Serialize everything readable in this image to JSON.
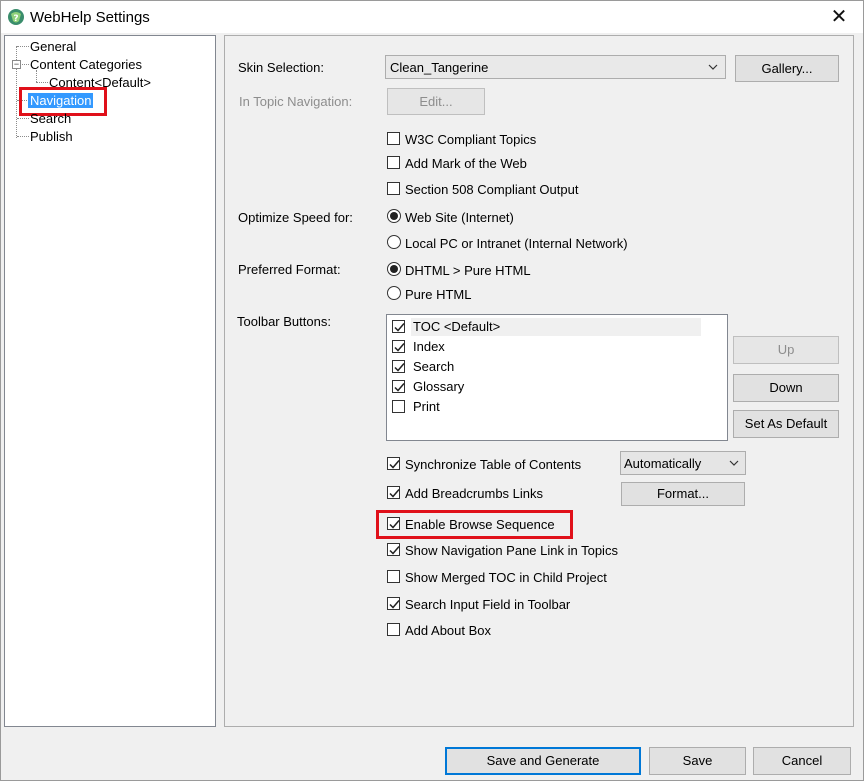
{
  "window": {
    "title": "WebHelp Settings",
    "close_glyph": "✕"
  },
  "tree": {
    "general": "General",
    "content_categories": "Content Categories",
    "content_default": "Content<Default>",
    "navigation": "Navigation",
    "search": "Search",
    "publish": "Publish",
    "expander_glyph": "−"
  },
  "skin": {
    "label": "Skin Selection:",
    "value": "Clean_Tangerine",
    "gallery": "Gallery..."
  },
  "in_topic": {
    "label": "In Topic Navigation:",
    "edit": "Edit..."
  },
  "checks_top": [
    {
      "label": "W3C Compliant Topics",
      "checked": false
    },
    {
      "label": "Add Mark of the Web",
      "checked": false
    },
    {
      "label": "Section 508 Compliant Output",
      "checked": false
    }
  ],
  "optimize": {
    "label": "Optimize Speed for:",
    "options": [
      "Web Site (Internet)",
      "Local PC or Intranet (Internal Network)"
    ],
    "selected": 0
  },
  "format": {
    "label": "Preferred Format:",
    "options": [
      "DHTML > Pure HTML",
      "Pure HTML"
    ],
    "selected": 0
  },
  "toolbar": {
    "label": "Toolbar Buttons:",
    "items": [
      {
        "label": "TOC <Default>",
        "checked": true
      },
      {
        "label": "Index",
        "checked": true
      },
      {
        "label": "Search",
        "checked": true
      },
      {
        "label": "Glossary",
        "checked": true
      },
      {
        "label": "Print",
        "checked": false
      }
    ],
    "up": "Up",
    "down": "Down",
    "set_default": "Set As Default"
  },
  "sync": {
    "label": "Synchronize Table of Contents",
    "checked": true,
    "combo": "Automatically"
  },
  "breadcrumbs": {
    "label": "Add Breadcrumbs Links",
    "checked": true,
    "format_btn": "Format..."
  },
  "checks_bottom": [
    {
      "label": "Enable Browse Sequence",
      "checked": true
    },
    {
      "label": "Show Navigation Pane Link in Topics",
      "checked": true
    },
    {
      "label": "Show Merged TOC in Child Project",
      "checked": false
    },
    {
      "label": "Search Input Field in Toolbar",
      "checked": true
    },
    {
      "label": "Add About Box",
      "checked": false
    }
  ],
  "footer": {
    "save_generate": "Save and Generate",
    "save": "Save",
    "cancel": "Cancel"
  },
  "colors": {
    "accent": "#0078d7",
    "highlight": "#e0101a",
    "selection": "#3399ff"
  }
}
